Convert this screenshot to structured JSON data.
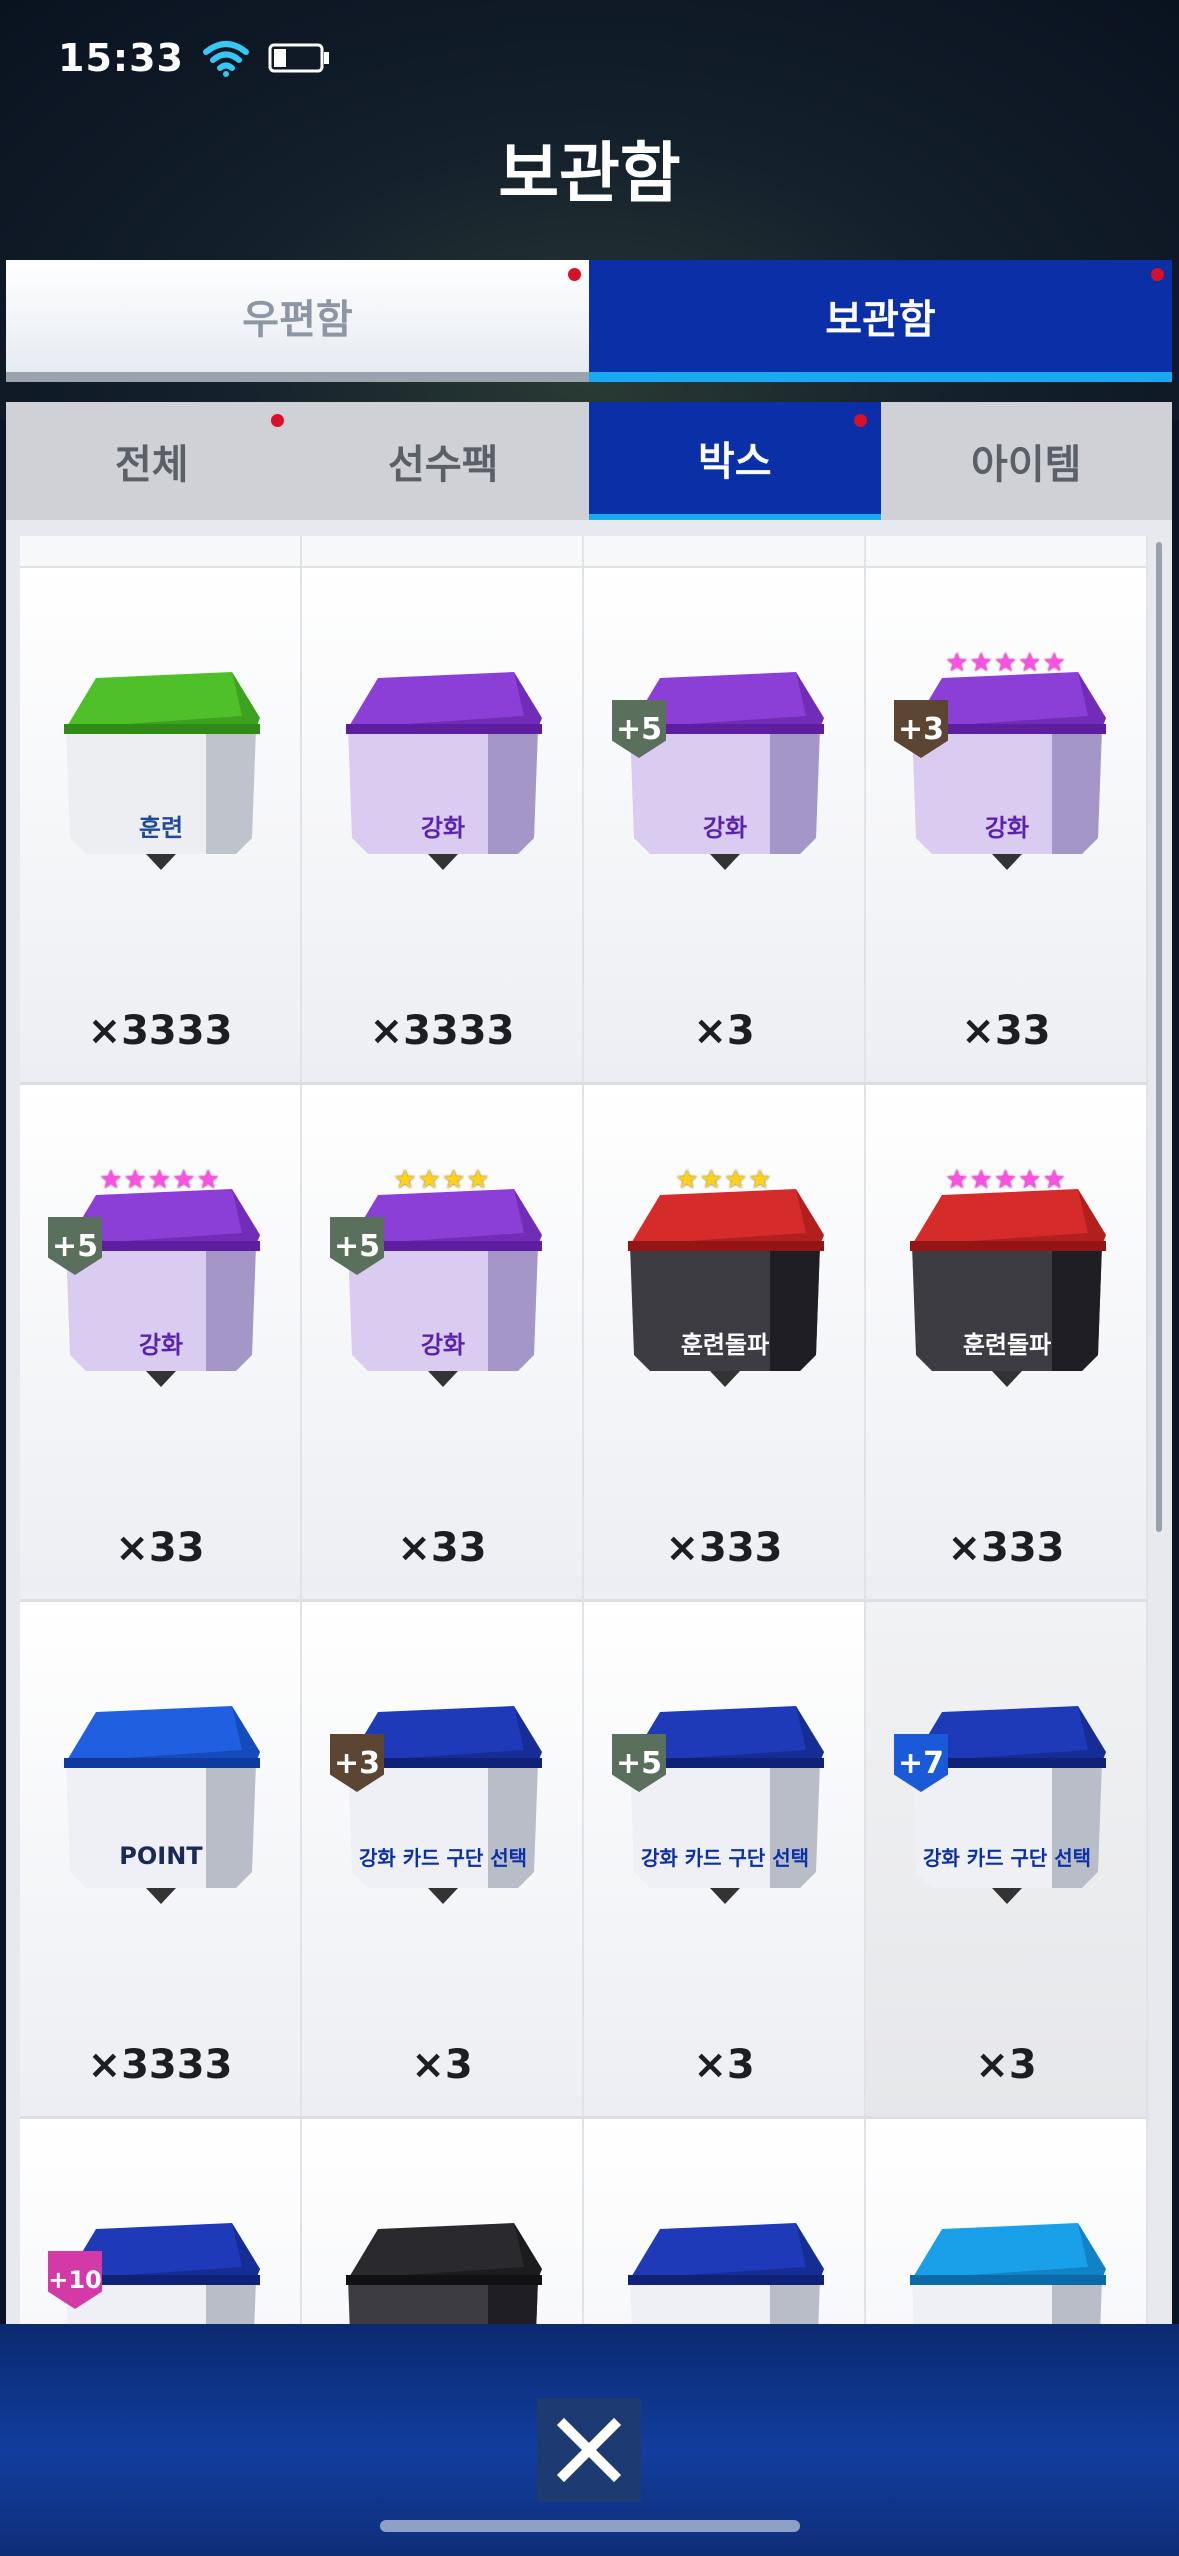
{
  "status": {
    "time": "15:33"
  },
  "header": {
    "title": "보관함"
  },
  "main_tabs": [
    {
      "label": "우편함",
      "active": false
    },
    {
      "label": "보관함",
      "active": true
    }
  ],
  "sub_tabs": [
    {
      "label": "전체",
      "active": false
    },
    {
      "label": "선수팩",
      "active": false
    },
    {
      "label": "박스",
      "active": true
    },
    {
      "label": "아이템",
      "active": false
    }
  ],
  "colors": {
    "accent_blue": "#0a2fa6",
    "notify_red": "#d8102a",
    "tab_underline": "#1aa9f0"
  },
  "items": [
    {
      "box": "green",
      "emblem_text": "훈련",
      "badge": "",
      "stars": "",
      "star_color": "",
      "count": "×3333"
    },
    {
      "box": "purple",
      "emblem_text": "강화",
      "badge": "",
      "stars": "",
      "star_color": "",
      "count": "×3333"
    },
    {
      "box": "purple",
      "emblem_text": "강화",
      "badge": "+5",
      "stars": "",
      "star_color": "",
      "count": "×3"
    },
    {
      "box": "purple",
      "emblem_text": "강화",
      "badge": "+3",
      "stars": "★★★★★",
      "star_color": "pink",
      "count": "×33"
    },
    {
      "box": "purple",
      "emblem_text": "강화",
      "badge": "+5",
      "stars": "★★★★★",
      "star_color": "pink",
      "count": "×33"
    },
    {
      "box": "purple",
      "emblem_text": "강화",
      "badge": "+5",
      "stars": "★★★★",
      "star_color": "gold",
      "count": "×33"
    },
    {
      "box": "red",
      "emblem_text": "훈련돌파",
      "badge": "",
      "stars": "★★★★",
      "star_color": "gold",
      "count": "×333"
    },
    {
      "box": "red",
      "emblem_text": "훈련돌파",
      "badge": "",
      "stars": "★★★★★",
      "star_color": "pink",
      "count": "×333"
    },
    {
      "box": "blue",
      "emblem_text": "POINT",
      "badge": "",
      "stars": "",
      "star_color": "",
      "count": "×3333"
    },
    {
      "box": "navy",
      "emblem_text": "강화 카드 구단 선택",
      "badge": "+3",
      "stars": "",
      "star_color": "",
      "count": "×3"
    },
    {
      "box": "navy",
      "emblem_text": "강화 카드 구단 선택",
      "badge": "+5",
      "stars": "",
      "star_color": "",
      "count": "×3"
    },
    {
      "box": "navy",
      "emblem_text": "강화 카드 구단 선택",
      "badge": "+7",
      "stars": "",
      "star_color": "",
      "count": "×3"
    },
    {
      "box": "navy",
      "emblem_text": "",
      "badge": "+10",
      "stars": "",
      "star_color": "",
      "count": ""
    },
    {
      "box": "black",
      "emblem_text": "",
      "badge": "",
      "stars": "",
      "star_color": "",
      "count": ""
    },
    {
      "box": "navy",
      "emblem_text": "",
      "badge": "",
      "stars": "",
      "star_color": "",
      "count": ""
    },
    {
      "box": "cyan",
      "emblem_text": "",
      "badge": "",
      "stars": "",
      "star_color": "",
      "count": ""
    }
  ]
}
